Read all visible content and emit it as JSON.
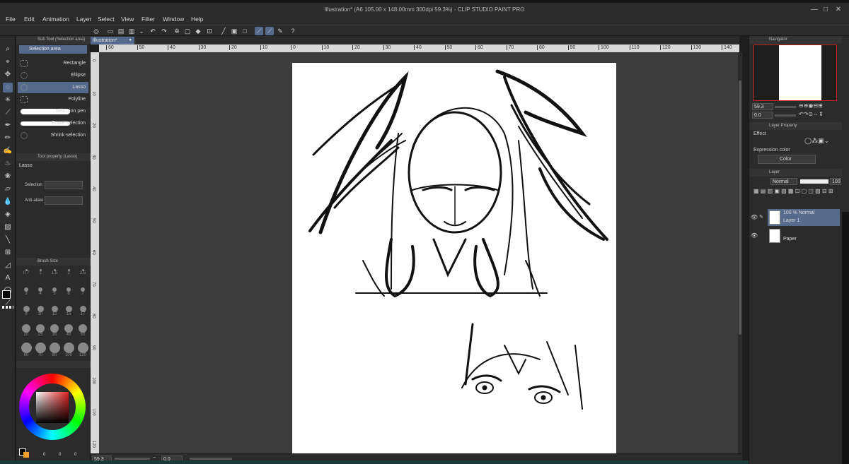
{
  "window": {
    "title": "Illustration* (A6 105.00 x 148.00mm 300dpi 59.3%) - CLIP STUDIO PAINT PRO",
    "controls": [
      "—",
      "□",
      "✕"
    ]
  },
  "menu": [
    "File",
    "Edit",
    "Animation",
    "Layer",
    "Select",
    "View",
    "Filter",
    "Window",
    "Help"
  ],
  "document_tab": "Illustration*",
  "sub_tool_panel": {
    "header": "Sub Tool (Selection area)",
    "group": "Selection area",
    "items": [
      "Rectangle",
      "Ellipse",
      "Lasso",
      "Polyline",
      "Selection pen",
      "Erase selection",
      "Shrink selection"
    ],
    "selected": "Lasso"
  },
  "tool_property_panel": {
    "header": "Tool property (Lasso)",
    "tool_name": "Lasso",
    "selection_label": "Selection",
    "antialias_label": "Anti-aliasi"
  },
  "brush_size_panel": {
    "header": "Brush Size",
    "sizes": [
      "0.7",
      "1",
      "1.5",
      "2",
      "2.5",
      "3",
      "4",
      "5",
      "6",
      "7",
      "8",
      "10",
      "12",
      "15",
      "17",
      "20",
      "25",
      "30",
      "40",
      "50",
      "60",
      "70",
      "80",
      "100",
      "120"
    ]
  },
  "color_panel": {
    "values": [
      "0",
      "0",
      "0"
    ],
    "main_color": "#000000",
    "sub_color": "#f0a030"
  },
  "ruler_top": [
    "60",
    "50",
    "40",
    "30",
    "20",
    "10",
    "0",
    "10",
    "20",
    "30",
    "40",
    "50",
    "60",
    "70",
    "80",
    "90",
    "100",
    "110",
    "120",
    "130",
    "140"
  ],
  "ruler_left": [
    "0",
    "10",
    "20",
    "30",
    "40",
    "50",
    "60",
    "70",
    "80",
    "90",
    "100",
    "110",
    "120"
  ],
  "bottom_bar": {
    "zoom": "59.3",
    "rotation": "0.0"
  },
  "navigator": {
    "header": "Navigator",
    "zoom": "59.3",
    "rotation": "0.0"
  },
  "layer_property": {
    "header": "Layer Property",
    "effect_label": "Effect",
    "expression_label": "Expression color",
    "expression_value": "Color"
  },
  "layer_panel": {
    "header": "Layer",
    "blend_mode": "Normal",
    "opacity": "100",
    "layers": [
      {
        "line1": "100 % Normal",
        "line2": "Layer 1"
      },
      {
        "line1": "",
        "line2": "Paper"
      }
    ]
  },
  "colors": {
    "accent": "#566b8c",
    "panel": "#2b2b2b",
    "canvas_bg": "#3c3c3c"
  }
}
